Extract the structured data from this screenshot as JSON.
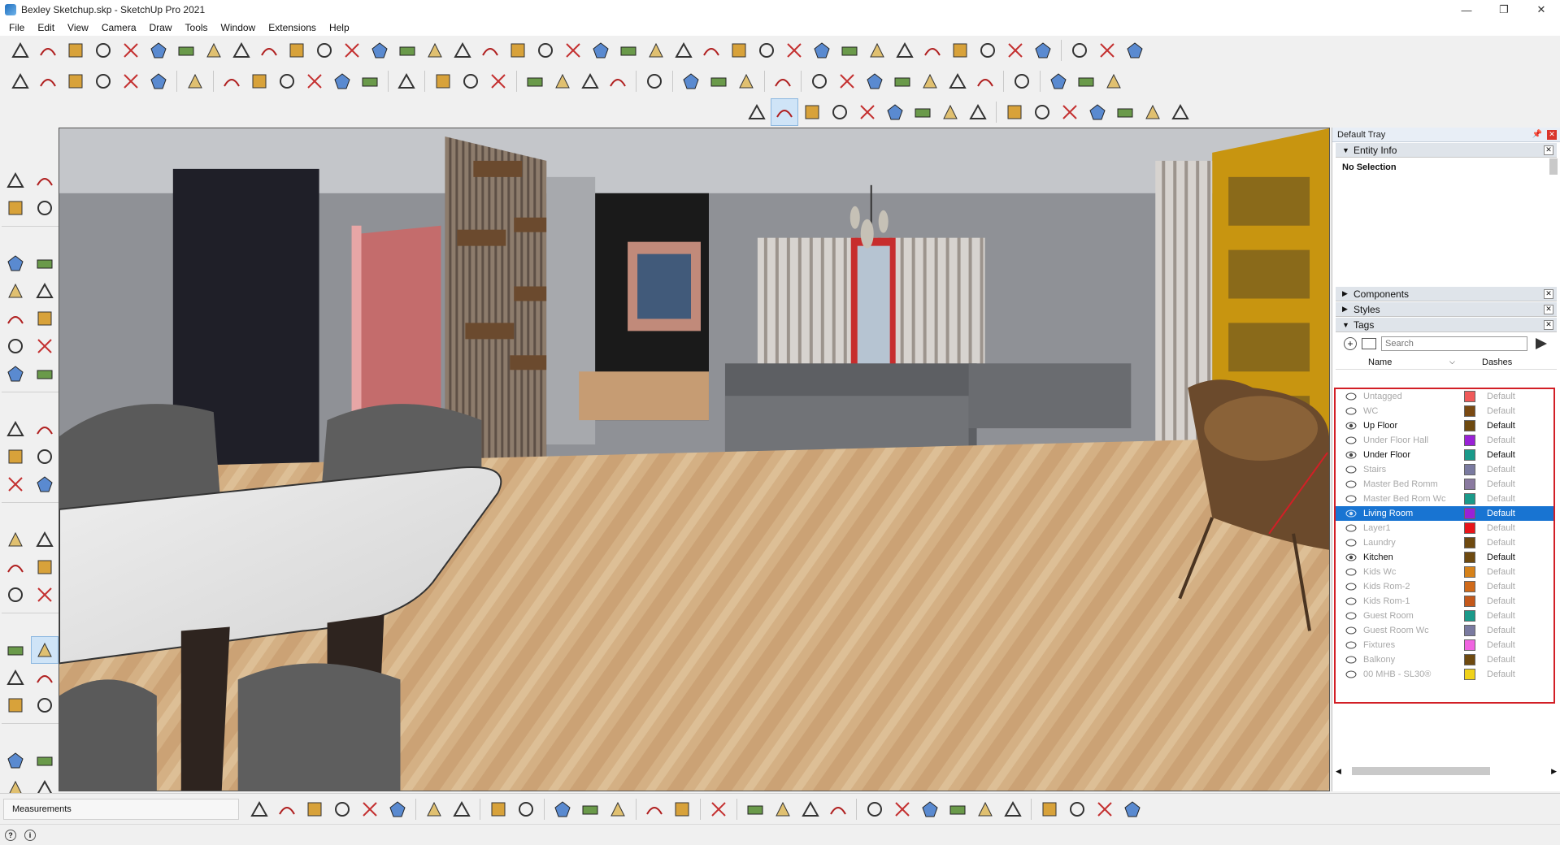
{
  "window": {
    "title": "Bexley Sketchup.skp - SketchUp Pro 2021",
    "minimize": "—",
    "maximize": "❐",
    "close": "✕"
  },
  "menu": [
    "File",
    "Edit",
    "View",
    "Camera",
    "Draw",
    "Tools",
    "Window",
    "Extensions",
    "Help"
  ],
  "tray": {
    "title": "Default Tray",
    "entity_info": {
      "label": "Entity Info",
      "selection": "No Selection"
    },
    "components": {
      "label": "Components"
    },
    "styles": {
      "label": "Styles"
    },
    "tags": {
      "label": "Tags",
      "search_placeholder": "Search",
      "columns": {
        "name": "Name",
        "dashes": "Dashes"
      },
      "items": [
        {
          "name": "Untagged",
          "color": "#f05a5a",
          "dashes": "Default",
          "visible": false
        },
        {
          "name": "WC",
          "color": "#7a4a12",
          "dashes": "Default",
          "visible": false
        },
        {
          "name": "Up Floor",
          "color": "#6e4a10",
          "dashes": "Default",
          "visible": true
        },
        {
          "name": "Under Floor Hall",
          "color": "#9a21d6",
          "dashes": "Default",
          "visible": false
        },
        {
          "name": "Under Floor",
          "color": "#1a9a8a",
          "dashes": "Default",
          "visible": true
        },
        {
          "name": "Stairs",
          "color": "#7a7aa0",
          "dashes": "Default",
          "visible": false
        },
        {
          "name": "Master Bed Romm",
          "color": "#8a7aa0",
          "dashes": "Default",
          "visible": false
        },
        {
          "name": "Master Bed Rom Wc",
          "color": "#1a9a8a",
          "dashes": "Default",
          "visible": false
        },
        {
          "name": "Living Room",
          "color": "#9a21d6",
          "dashes": "Default",
          "visible": true,
          "selected": true
        },
        {
          "name": "Layer1",
          "color": "#e8141a",
          "dashes": "Default",
          "visible": false
        },
        {
          "name": "Laundry",
          "color": "#6e4a10",
          "dashes": "Default",
          "visible": false
        },
        {
          "name": "Kitchen",
          "color": "#6e4a10",
          "dashes": "Default",
          "visible": true
        },
        {
          "name": "Kids Wc",
          "color": "#d6821a",
          "dashes": "Default",
          "visible": false
        },
        {
          "name": "Kids Rom-2",
          "color": "#d06a1a",
          "dashes": "Default",
          "visible": false
        },
        {
          "name": "Kids Rom-1",
          "color": "#c4581a",
          "dashes": "Default",
          "visible": false
        },
        {
          "name": "Guest Room",
          "color": "#1a9a8a",
          "dashes": "Default",
          "visible": false
        },
        {
          "name": "Guest Room Wc",
          "color": "#7a7aa0",
          "dashes": "Default",
          "visible": false
        },
        {
          "name": "Fixtures",
          "color": "#f064e0",
          "dashes": "Default",
          "visible": false
        },
        {
          "name": "Balkony",
          "color": "#6e4a10",
          "dashes": "Default",
          "visible": false
        },
        {
          "name": "00 MHB - SL30®",
          "color": "#f0d21a",
          "dashes": "Default",
          "visible": false
        }
      ]
    }
  },
  "status": {
    "measurements_label": "Measurements"
  },
  "colors": {
    "accent": "#1874d2",
    "highlight_border": "#d21f26"
  }
}
